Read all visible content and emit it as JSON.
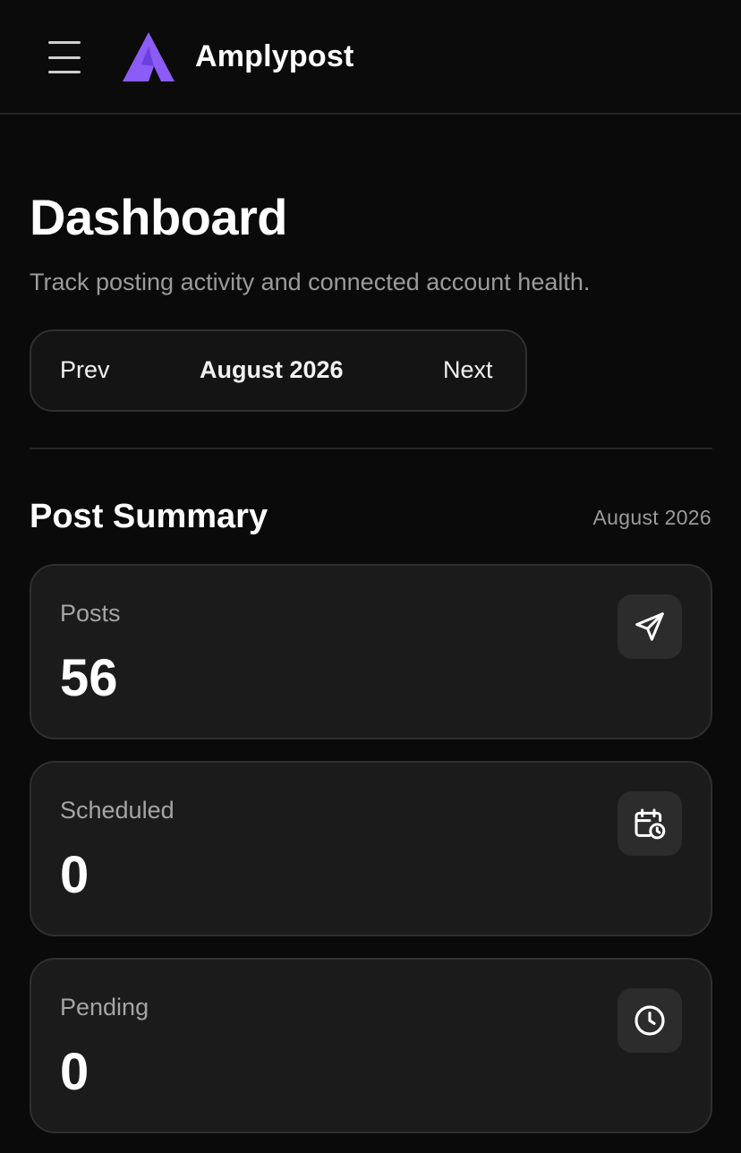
{
  "header": {
    "menu_icon": "hamburger-menu-icon",
    "logo_icon": "amplypost-logo-icon",
    "brand_color": "#8b5cf6",
    "app_name": "Amplypost"
  },
  "page": {
    "title": "Dashboard",
    "subtitle": "Track posting activity and connected account health."
  },
  "month_nav": {
    "prev_label": "Prev",
    "current_month": "August 2026",
    "next_label": "Next"
  },
  "summary": {
    "title": "Post Summary",
    "period": "August 2026",
    "cards": [
      {
        "label": "Posts",
        "value": "56",
        "icon": "send-icon"
      },
      {
        "label": "Scheduled",
        "value": "0",
        "icon": "calendar-clock-icon"
      },
      {
        "label": "Pending",
        "value": "0",
        "icon": "clock-icon"
      }
    ]
  }
}
